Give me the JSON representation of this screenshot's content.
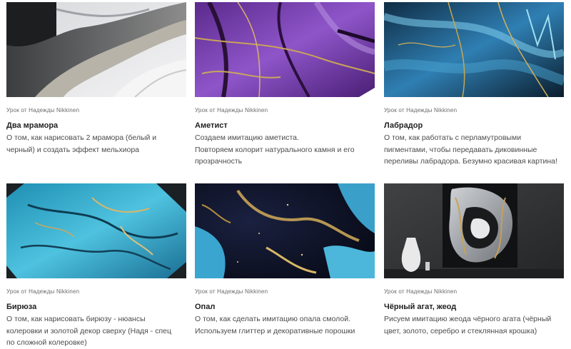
{
  "lessons": [
    {
      "author": "Урок от Надежды Nikkinen",
      "title": "Два мрамора",
      "description": "О том, как нарисовать 2 мрамора  (белый и\nчерный) и создать эффект мельхиора",
      "image_icon": "marble-painting-icon"
    },
    {
      "author": "Урок от Надежды Nikkinen",
      "title": "Аметист",
      "description": "Создаем имитацию аметиста.\nПовторяем колорит натурального камня и его\nпрозрачность",
      "image_icon": "amethyst-painting-icon"
    },
    {
      "author": "Урок от Надежды Nikkinen",
      "title": "Лабрадор",
      "description": "О том, как работать с перламутровыми\nпигментами, чтобы передавать диковинные\nпереливы лабрадора. Безумно красивая картина!",
      "image_icon": "labradorite-painting-icon"
    },
    {
      "author": "Урок от Надежды Nikkinen",
      "title": "Бирюза",
      "description": "О том, как нарисовать бирюзу  - нюансы\nколеровки и золотой декор сверху (Надя - спец\nпо сложной колеровке)",
      "image_icon": "turquoise-painting-icon"
    },
    {
      "author": "Урок от Надежды Nikkinen",
      "title": "Опал",
      "description": "О том, как сделать имитацию опала смолой.\nИспользуем  глиттер и декоративные порошки",
      "image_icon": "opal-painting-icon"
    },
    {
      "author": "Урок от Надежды Nikkinen",
      "title": "Чёрный агат, жеод",
      "description": "Рисуем имитацию жеода чёрного агата (чёрный\nцвет, золото, серебро и стеклянная крошка)",
      "image_icon": "black-agate-geode-painting-icon"
    }
  ]
}
